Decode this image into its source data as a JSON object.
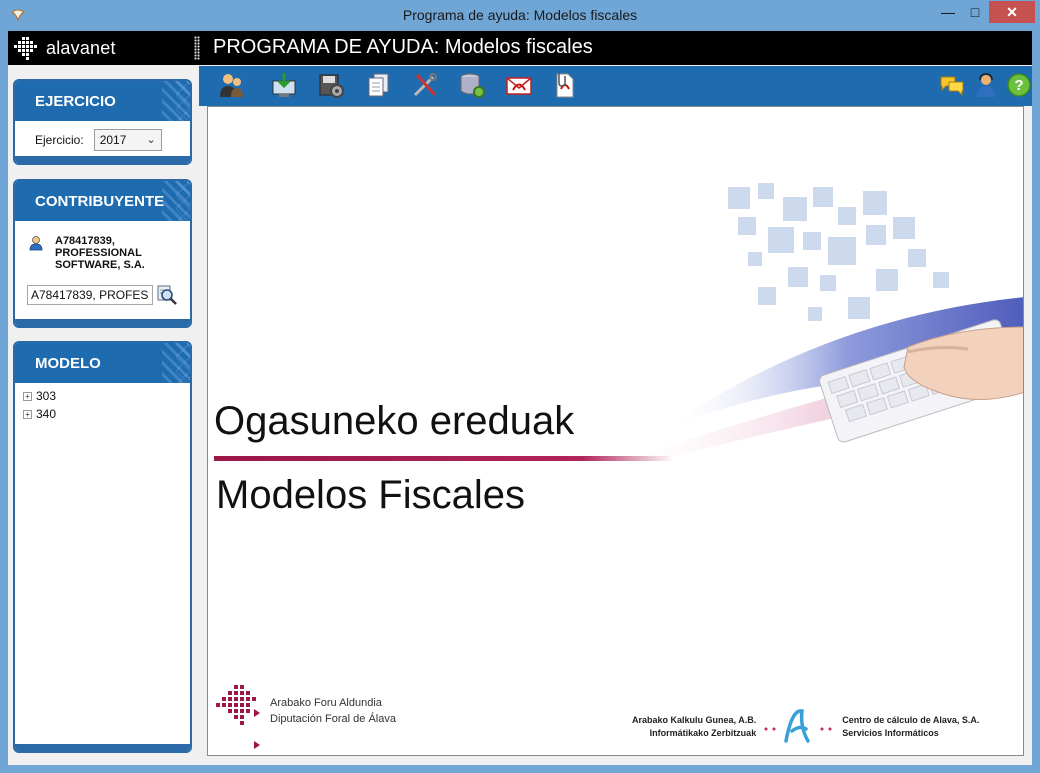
{
  "window": {
    "title": "Programa de ayuda: Modelos fiscales"
  },
  "header": {
    "logo_text": "alavanet",
    "title": "PROGRAMA DE AYUDA: Modelos fiscales"
  },
  "ejercicio": {
    "heading": "EJERCICIO",
    "label": "Ejercicio:",
    "value": "2017"
  },
  "contribuyente": {
    "heading": "CONTRIBUYENTE",
    "name": "A78417839, PROFESSIONAL SOFTWARE, S.A.",
    "input_value": "A78417839, PROFES"
  },
  "modelo": {
    "heading": "MODELO",
    "items": [
      {
        "label": "303"
      },
      {
        "label": "340"
      }
    ]
  },
  "toolbar": {
    "left_icons": [
      "user-admin-icon",
      "download-icon",
      "disk-settings-icon",
      "copy-documents-icon",
      "tools-icon",
      "database-settings-icon",
      "pdf-mail-icon",
      "pdf-attachment-icon"
    ],
    "right_icons": [
      "chat-icon",
      "support-user-icon",
      "help-icon"
    ]
  },
  "content": {
    "title_eu": "Ogasuneko ereduak",
    "title_es": "Modelos Fiscales",
    "footer_left": {
      "line1": "Arabako Foru Aldundia",
      "line2": "Diputación Foral de Álava"
    },
    "footer_right": {
      "left_line1": "Arabako Kalkulu Gunea, A.B.",
      "left_line2": "Informátikako Zerbitzuak",
      "right_line1": "Centro de cálculo de Alava, S.A.",
      "right_line2": "Servicios Informáticos"
    }
  },
  "colors": {
    "accent": "#1e6bb0",
    "brand_magenta": "#9a1748",
    "title_bar": "#6fa6d6",
    "close": "#c75050"
  }
}
